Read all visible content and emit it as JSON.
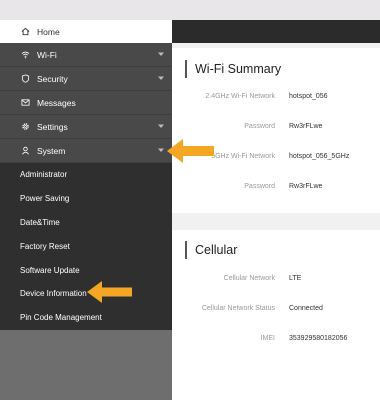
{
  "sidebar": {
    "items": [
      {
        "label": "Home",
        "icon": "home-icon"
      },
      {
        "label": "Wi-Fi",
        "icon": "wifi-icon"
      },
      {
        "label": "Security",
        "icon": "shield-icon"
      },
      {
        "label": "Messages",
        "icon": "mail-icon"
      },
      {
        "label": "Settings",
        "icon": "gear-icon"
      },
      {
        "label": "System",
        "icon": "user-icon"
      }
    ],
    "system_submenu": [
      {
        "label": "Administrator"
      },
      {
        "label": "Power Saving"
      },
      {
        "label": "Date&Time"
      },
      {
        "label": "Factory Reset"
      },
      {
        "label": "Software Update"
      },
      {
        "label": "Device Information"
      },
      {
        "label": "Pin Code Management"
      }
    ]
  },
  "wifi_summary": {
    "title": "Wi-Fi Summary",
    "rows": [
      {
        "label": "2.4GHz Wi-Fi Network",
        "value": "hotspot_056"
      },
      {
        "label": "Password",
        "value": "Rw3rFLwe"
      },
      {
        "label": "5GHz Wi-Fi Network",
        "value": "hotspot_056_5GHz"
      },
      {
        "label": "Password",
        "value": "Rw3rFLwe"
      }
    ]
  },
  "cellular": {
    "title": "Cellular",
    "rows": [
      {
        "label": "Cellular Network",
        "value": "LTE"
      },
      {
        "label": "Cellular Network Status",
        "value": "Connected"
      },
      {
        "label": "IMEI",
        "value": "353929580182056"
      }
    ]
  },
  "colors": {
    "accent_arrow": "#f5a623",
    "header_dark": "#2b2b2b",
    "submenu_bg": "#2f2f2f"
  }
}
